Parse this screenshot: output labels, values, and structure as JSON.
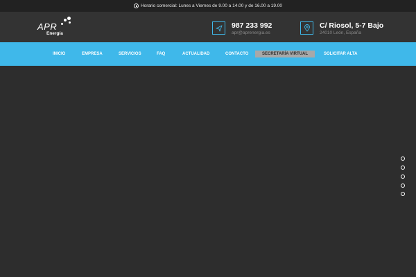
{
  "topbar": {
    "hours": "Horario comercial: Lunes a Viernes de 9.00 a 14.00 y de 16.00 a 19.00"
  },
  "logo": {
    "main": "APR",
    "sub": "Energía"
  },
  "contact": {
    "phone": "987 233 992",
    "email": "apr@aprenergia.es",
    "address": "C/ Riosol, 5-7 Bajo",
    "city": "24010 León, España"
  },
  "nav": {
    "items": [
      "INICIO",
      "EMPRESA",
      "SERVICIOS",
      "FAQ",
      "ACTUALIDAD",
      "CONTACTO",
      "SECRETARÍA VIRTUAL",
      "SOLICITAR ALTA"
    ]
  },
  "colors": {
    "accent": "#3fb8ea",
    "dark": "#2d2d2d",
    "header": "#333333",
    "topbar": "#222222"
  }
}
